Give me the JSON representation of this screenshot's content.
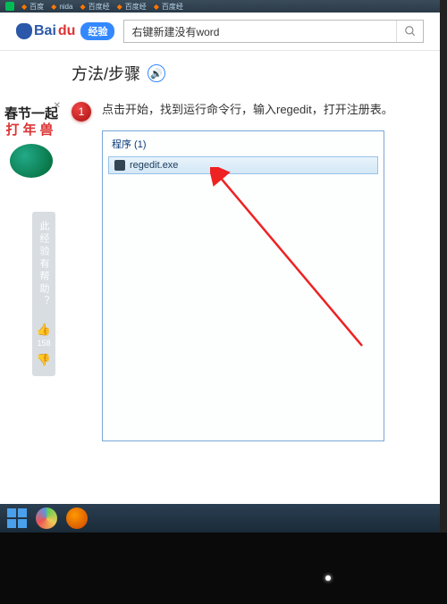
{
  "browser": {
    "tabs": [
      "百度",
      "nida",
      "百度经",
      "百度经",
      "百度经"
    ]
  },
  "header": {
    "logo_main": "Bai",
    "logo_accent": "du",
    "logo_badge": "经验",
    "search_value": "右键新建没有word"
  },
  "side_promo": {
    "line1": "春节一起",
    "line2": "打年兽"
  },
  "feedback": {
    "label": "此经验有帮助？",
    "count": "158"
  },
  "article": {
    "section_title": "方法/步骤",
    "step_num": "1",
    "step_text": "点击开始，找到运行命令行，输入regedit，打开注册表。"
  },
  "shot": {
    "program_label": "程序 (1)",
    "result_text": "regedit.exe"
  }
}
